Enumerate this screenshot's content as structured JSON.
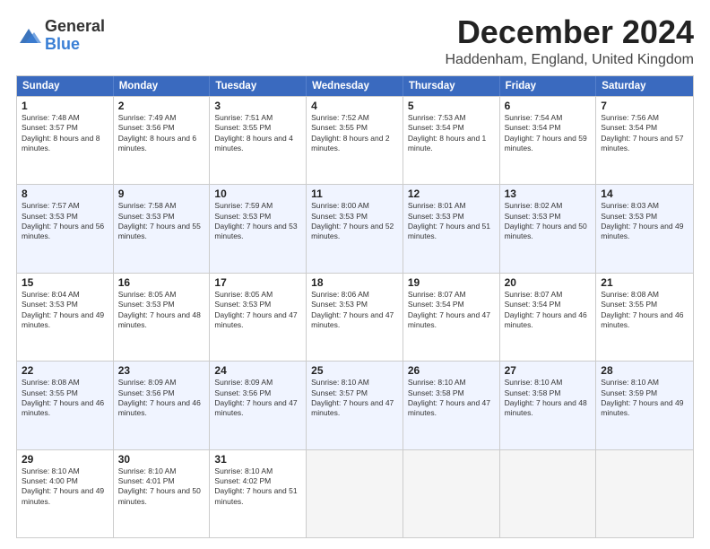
{
  "logo": {
    "line1": "General",
    "line2": "Blue"
  },
  "title": "December 2024",
  "location": "Haddenham, England, United Kingdom",
  "headers": [
    "Sunday",
    "Monday",
    "Tuesday",
    "Wednesday",
    "Thursday",
    "Friday",
    "Saturday"
  ],
  "weeks": [
    [
      {
        "day": "1",
        "sunrise": "Sunrise: 7:48 AM",
        "sunset": "Sunset: 3:57 PM",
        "daylight": "Daylight: 8 hours and 8 minutes."
      },
      {
        "day": "2",
        "sunrise": "Sunrise: 7:49 AM",
        "sunset": "Sunset: 3:56 PM",
        "daylight": "Daylight: 8 hours and 6 minutes."
      },
      {
        "day": "3",
        "sunrise": "Sunrise: 7:51 AM",
        "sunset": "Sunset: 3:55 PM",
        "daylight": "Daylight: 8 hours and 4 minutes."
      },
      {
        "day": "4",
        "sunrise": "Sunrise: 7:52 AM",
        "sunset": "Sunset: 3:55 PM",
        "daylight": "Daylight: 8 hours and 2 minutes."
      },
      {
        "day": "5",
        "sunrise": "Sunrise: 7:53 AM",
        "sunset": "Sunset: 3:54 PM",
        "daylight": "Daylight: 8 hours and 1 minute."
      },
      {
        "day": "6",
        "sunrise": "Sunrise: 7:54 AM",
        "sunset": "Sunset: 3:54 PM",
        "daylight": "Daylight: 7 hours and 59 minutes."
      },
      {
        "day": "7",
        "sunrise": "Sunrise: 7:56 AM",
        "sunset": "Sunset: 3:54 PM",
        "daylight": "Daylight: 7 hours and 57 minutes."
      }
    ],
    [
      {
        "day": "8",
        "sunrise": "Sunrise: 7:57 AM",
        "sunset": "Sunset: 3:53 PM",
        "daylight": "Daylight: 7 hours and 56 minutes."
      },
      {
        "day": "9",
        "sunrise": "Sunrise: 7:58 AM",
        "sunset": "Sunset: 3:53 PM",
        "daylight": "Daylight: 7 hours and 55 minutes."
      },
      {
        "day": "10",
        "sunrise": "Sunrise: 7:59 AM",
        "sunset": "Sunset: 3:53 PM",
        "daylight": "Daylight: 7 hours and 53 minutes."
      },
      {
        "day": "11",
        "sunrise": "Sunrise: 8:00 AM",
        "sunset": "Sunset: 3:53 PM",
        "daylight": "Daylight: 7 hours and 52 minutes."
      },
      {
        "day": "12",
        "sunrise": "Sunrise: 8:01 AM",
        "sunset": "Sunset: 3:53 PM",
        "daylight": "Daylight: 7 hours and 51 minutes."
      },
      {
        "day": "13",
        "sunrise": "Sunrise: 8:02 AM",
        "sunset": "Sunset: 3:53 PM",
        "daylight": "Daylight: 7 hours and 50 minutes."
      },
      {
        "day": "14",
        "sunrise": "Sunrise: 8:03 AM",
        "sunset": "Sunset: 3:53 PM",
        "daylight": "Daylight: 7 hours and 49 minutes."
      }
    ],
    [
      {
        "day": "15",
        "sunrise": "Sunrise: 8:04 AM",
        "sunset": "Sunset: 3:53 PM",
        "daylight": "Daylight: 7 hours and 49 minutes."
      },
      {
        "day": "16",
        "sunrise": "Sunrise: 8:05 AM",
        "sunset": "Sunset: 3:53 PM",
        "daylight": "Daylight: 7 hours and 48 minutes."
      },
      {
        "day": "17",
        "sunrise": "Sunrise: 8:05 AM",
        "sunset": "Sunset: 3:53 PM",
        "daylight": "Daylight: 7 hours and 47 minutes."
      },
      {
        "day": "18",
        "sunrise": "Sunrise: 8:06 AM",
        "sunset": "Sunset: 3:53 PM",
        "daylight": "Daylight: 7 hours and 47 minutes."
      },
      {
        "day": "19",
        "sunrise": "Sunrise: 8:07 AM",
        "sunset": "Sunset: 3:54 PM",
        "daylight": "Daylight: 7 hours and 47 minutes."
      },
      {
        "day": "20",
        "sunrise": "Sunrise: 8:07 AM",
        "sunset": "Sunset: 3:54 PM",
        "daylight": "Daylight: 7 hours and 46 minutes."
      },
      {
        "day": "21",
        "sunrise": "Sunrise: 8:08 AM",
        "sunset": "Sunset: 3:55 PM",
        "daylight": "Daylight: 7 hours and 46 minutes."
      }
    ],
    [
      {
        "day": "22",
        "sunrise": "Sunrise: 8:08 AM",
        "sunset": "Sunset: 3:55 PM",
        "daylight": "Daylight: 7 hours and 46 minutes."
      },
      {
        "day": "23",
        "sunrise": "Sunrise: 8:09 AM",
        "sunset": "Sunset: 3:56 PM",
        "daylight": "Daylight: 7 hours and 46 minutes."
      },
      {
        "day": "24",
        "sunrise": "Sunrise: 8:09 AM",
        "sunset": "Sunset: 3:56 PM",
        "daylight": "Daylight: 7 hours and 47 minutes."
      },
      {
        "day": "25",
        "sunrise": "Sunrise: 8:10 AM",
        "sunset": "Sunset: 3:57 PM",
        "daylight": "Daylight: 7 hours and 47 minutes."
      },
      {
        "day": "26",
        "sunrise": "Sunrise: 8:10 AM",
        "sunset": "Sunset: 3:58 PM",
        "daylight": "Daylight: 7 hours and 47 minutes."
      },
      {
        "day": "27",
        "sunrise": "Sunrise: 8:10 AM",
        "sunset": "Sunset: 3:58 PM",
        "daylight": "Daylight: 7 hours and 48 minutes."
      },
      {
        "day": "28",
        "sunrise": "Sunrise: 8:10 AM",
        "sunset": "Sunset: 3:59 PM",
        "daylight": "Daylight: 7 hours and 49 minutes."
      }
    ],
    [
      {
        "day": "29",
        "sunrise": "Sunrise: 8:10 AM",
        "sunset": "Sunset: 4:00 PM",
        "daylight": "Daylight: 7 hours and 49 minutes."
      },
      {
        "day": "30",
        "sunrise": "Sunrise: 8:10 AM",
        "sunset": "Sunset: 4:01 PM",
        "daylight": "Daylight: 7 hours and 50 minutes."
      },
      {
        "day": "31",
        "sunrise": "Sunrise: 8:10 AM",
        "sunset": "Sunset: 4:02 PM",
        "daylight": "Daylight: 7 hours and 51 minutes."
      },
      {
        "day": "",
        "sunrise": "",
        "sunset": "",
        "daylight": ""
      },
      {
        "day": "",
        "sunrise": "",
        "sunset": "",
        "daylight": ""
      },
      {
        "day": "",
        "sunrise": "",
        "sunset": "",
        "daylight": ""
      },
      {
        "day": "",
        "sunrise": "",
        "sunset": "",
        "daylight": ""
      }
    ]
  ]
}
